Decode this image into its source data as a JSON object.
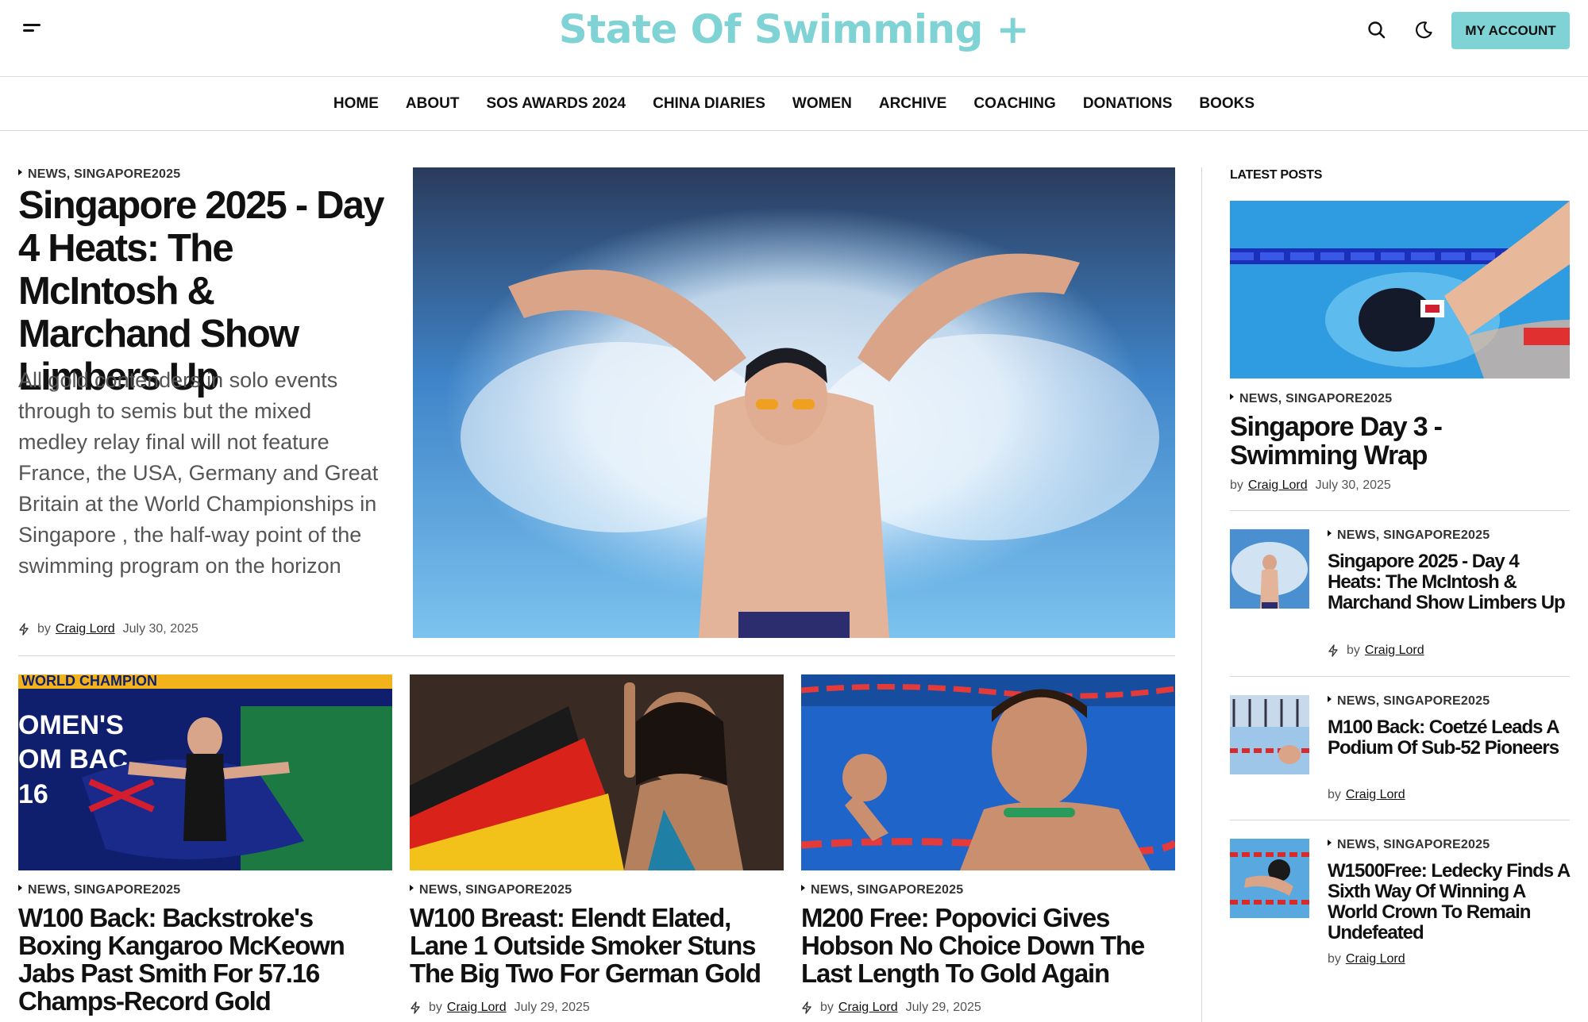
{
  "header": {
    "site_title": "State Of Swimming +",
    "account_label": "MY ACCOUNT",
    "brand_color": "#7fd3d5",
    "icons": [
      "menu-icon",
      "search-icon",
      "moon-icon"
    ]
  },
  "nav": {
    "items": [
      "HOME",
      "ABOUT",
      "SOS AWARDS 2024",
      "CHINA DIARIES",
      "WOMEN",
      "ARCHIVE",
      "COACHING",
      "DONATIONS",
      "BOOKS"
    ]
  },
  "featured": {
    "category": "NEWS, SINGAPORE2025",
    "title": "Singapore 2025 - Day 4 Heats: The McIntosh & Marchand Show Limbers Up",
    "excerpt": "All gold contenders in solo events through to semis but the mixed medley relay final will not feature France, the USA, Germany and Great Britain at the World Championships in Singapore , the half-way point of the swimming program on the horizon",
    "by": "by",
    "author": "Craig Lord",
    "date": "July 30, 2025"
  },
  "cards": [
    {
      "category": "NEWS, SINGAPORE2025",
      "title": "W100 Back: Backstroke's Boxing Kangaroo McKeown Jabs Past Smith For 57.16 Champs-Record Gold",
      "image_text": [
        "WORLD CHAMPION",
        "OMEN'S",
        "OM BAC",
        "16"
      ]
    },
    {
      "category": "NEWS, SINGAPORE2025",
      "title": "W100 Breast: Elendt Elated, Lane 1 Outside Smoker Stuns The Big Two For German Gold",
      "by": "by",
      "author": "Craig Lord",
      "date": "July 29, 2025"
    },
    {
      "category": "NEWS, SINGAPORE2025",
      "title": "M200 Free: Popovici Gives Hobson No Choice Down The Last Length To Gold Again",
      "by": "by",
      "author": "Craig Lord",
      "date": "July 29, 2025"
    }
  ],
  "sidebar": {
    "heading": "LATEST POSTS",
    "lead": {
      "category": "NEWS, SINGAPORE2025",
      "title": "Singapore Day 3 - Swimming Wrap",
      "by": "by",
      "author": "Craig Lord",
      "date": "July 30, 2025"
    },
    "items": [
      {
        "category": "NEWS, SINGAPORE2025",
        "title": "Singapore 2025 - Day 4 Heats: The McIntosh & Marchand Show Limbers Up",
        "by": "by",
        "author": "Craig Lord"
      },
      {
        "category": "NEWS, SINGAPORE2025",
        "title": "M100 Back: Coetzé Leads A Podium Of Sub-52 Pioneers",
        "by": "by",
        "author": "Craig Lord"
      },
      {
        "category": "NEWS, SINGAPORE2025",
        "title": "W1500Free: Ledecky Finds A Sixth Way Of Winning A World Crown To Remain Undefeated",
        "by": "by",
        "author": "Craig Lord"
      }
    ]
  }
}
